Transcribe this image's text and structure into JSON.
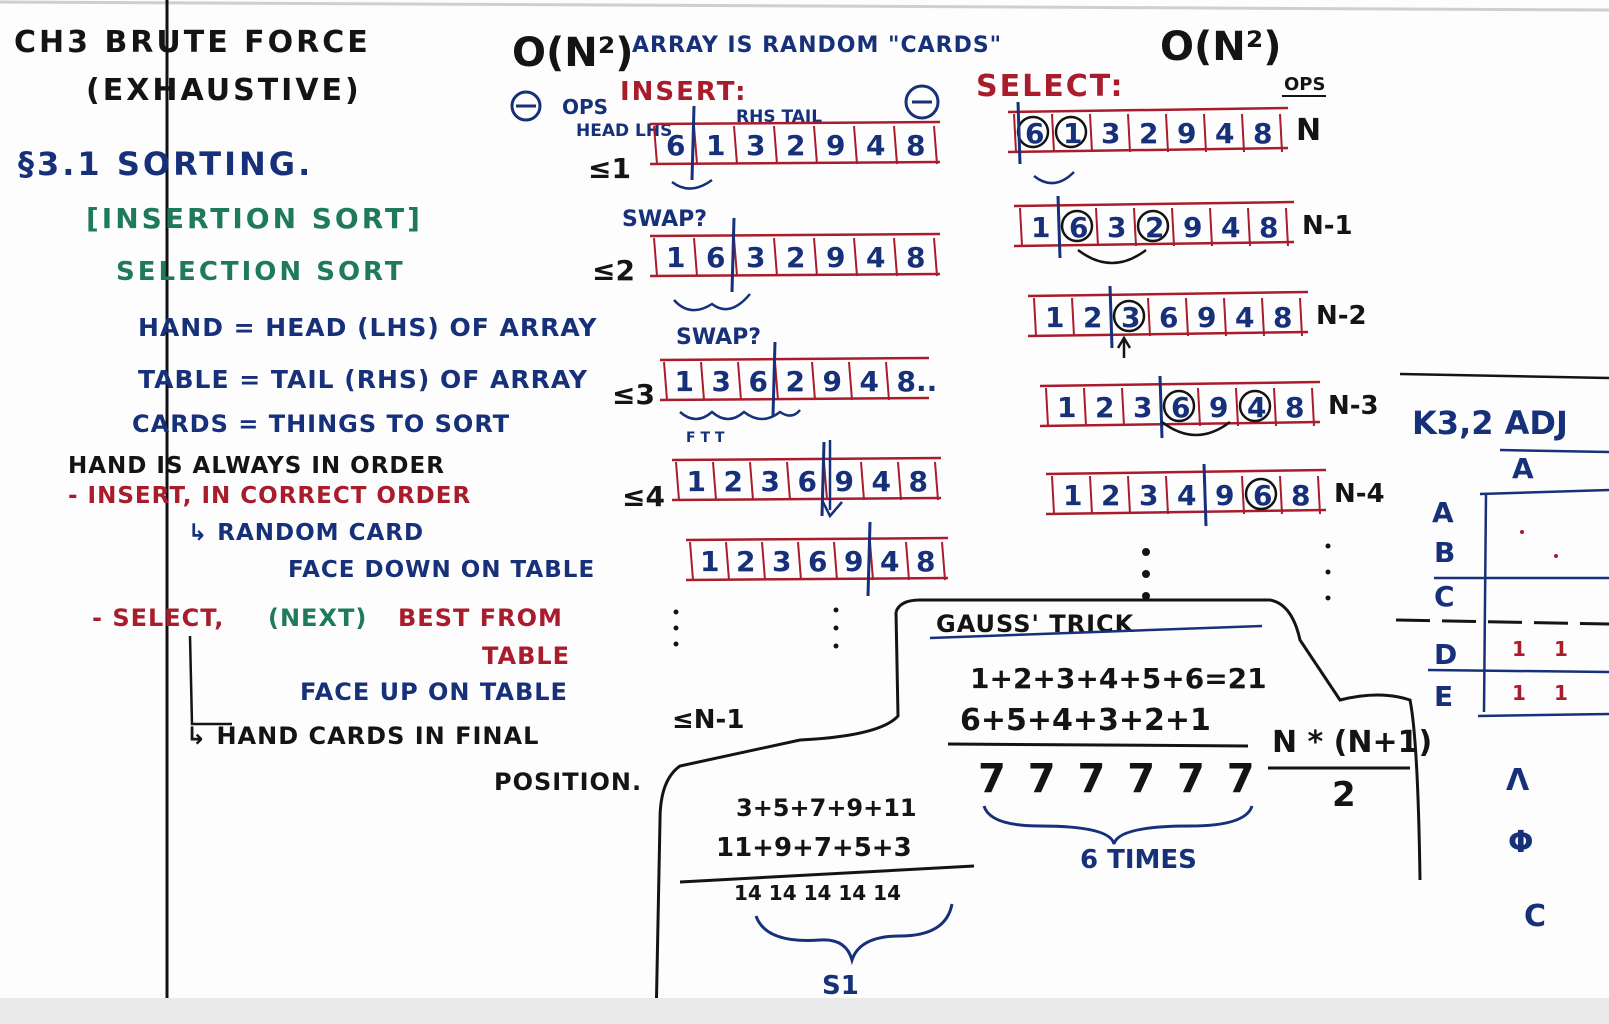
{
  "colors": {
    "black": "#141414",
    "blue": "#16307a",
    "red": "#a81c2c",
    "green": "#1f7a5a",
    "board": "#fdfdfd"
  },
  "notes": {
    "title_line1": "CH3 BRUTE FORCE",
    "title_line2": "(EXHAUSTIVE)",
    "section": "§3.1 SORTING.",
    "insertion_sort": "[INSERTION SORT]",
    "selection_sort": "SELECTION SORT",
    "hand_def": "HAND = HEAD (LHS) OF ARRAY",
    "table_def": "TABLE = TAIL (RHS) OF ARRAY",
    "cards_def": "CARDS = THINGS TO SORT",
    "hand_order": "HAND IS ALWAYS IN ORDER",
    "insert_line": "- INSERT, IN CORRECT ORDER",
    "random_card": "↳ RANDOM CARD",
    "face_down": "FACE DOWN ON TABLE",
    "select_prefix": "- SELECT,",
    "select_next": "(NEXT)",
    "select_best": "BEST FROM",
    "select_table": "TABLE",
    "face_up": "FACE UP ON TABLE",
    "hand_final": "↳ HAND CARDS IN FINAL",
    "position": "POSITION."
  },
  "insertion": {
    "complexity": "O(N²)",
    "array_note": "ARRAY IS RANDOM \"CARDS\"",
    "ops_label": "OPS",
    "heading": "INSERT:",
    "head_lhs": "HEAD LHS",
    "rhs_tail": "RHS TAIL",
    "ops_marks": [
      "≤1",
      "≤2",
      "≤3",
      "≤4",
      "≤N-1"
    ],
    "swap_1": "SWAP?",
    "swap_2": "SWAP?",
    "compare_marks": "F  T  T",
    "rows": [
      [
        "6",
        "1",
        "3",
        "2",
        "9",
        "4",
        "8"
      ],
      [
        "1",
        "6",
        "3",
        "2",
        "9",
        "4",
        "8"
      ],
      [
        "1",
        "3",
        "6",
        "2",
        "9",
        "4",
        "8.."
      ],
      [
        "1",
        "2",
        "3",
        "6",
        "9",
        "4",
        "8"
      ],
      [
        "1",
        "2",
        "3",
        "6",
        "9",
        "4",
        "8"
      ]
    ]
  },
  "selection": {
    "complexity": "O(N²)",
    "heading": "SELECT:",
    "ops_label": "OPS",
    "op_counts": [
      "N",
      "N-1",
      "N-2",
      "N-3",
      "N-4"
    ],
    "rows": [
      [
        "6",
        "1",
        "3",
        "2",
        "9",
        "4",
        "8"
      ],
      [
        "1",
        "6",
        "3",
        "2",
        "9",
        "4",
        "8"
      ],
      [
        "1",
        "2",
        "3",
        "6",
        "9",
        "4",
        "8"
      ],
      [
        "1",
        "2",
        "3",
        "6",
        "9",
        "4",
        "8"
      ],
      [
        "1",
        "2",
        "3",
        "4",
        "9",
        "6",
        "8"
      ]
    ]
  },
  "gauss": {
    "title": "GAUSS' TRICK",
    "sum_forward": "1+2+3+4+5+6=21",
    "sum_reverse": "6+5+4+3+2+1",
    "pair_sums": "7 7 7 7 7 7",
    "times": "6 TIMES",
    "formula_num": "N * (N+1)",
    "formula_den": "2"
  },
  "example": {
    "sum_forward": "3+5+7+9+11",
    "sum_reverse": "11+9+7+5+3",
    "pair_sums": "14 14 14 14 14",
    "bottom_label": "S1"
  },
  "graph": {
    "title": "K3,2 ADJ",
    "header_letter": "A",
    "row_labels": [
      "A",
      "B",
      "C",
      "D",
      "E"
    ],
    "marks": [
      "1",
      "1",
      "1",
      "1"
    ]
  }
}
